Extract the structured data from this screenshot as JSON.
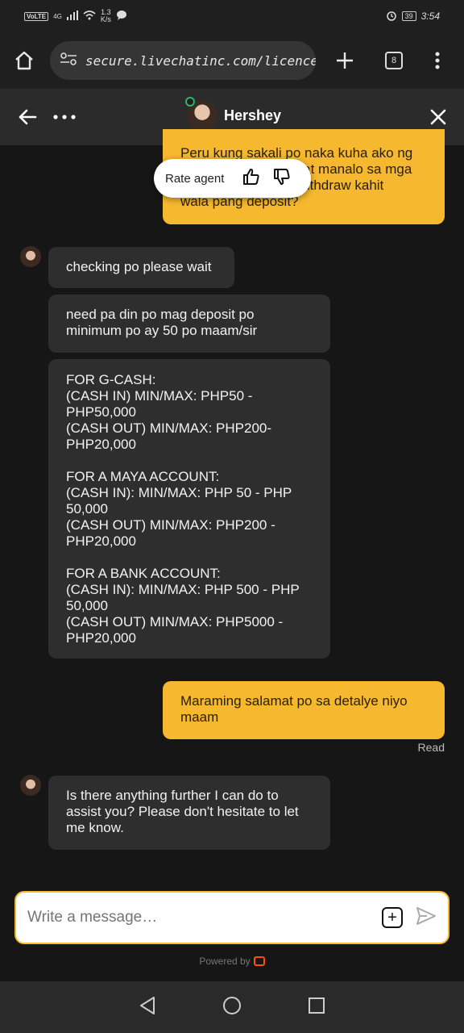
{
  "status_bar": {
    "network": "VoLTE",
    "signal_type": "4G",
    "speed": "1.3",
    "speed_unit": "K/s",
    "battery": "39",
    "time": "3:54"
  },
  "browser": {
    "url": "secure.livechatinc.com/licence/",
    "tab_count": "8"
  },
  "chat_header": {
    "agent_name": "Hershey",
    "status_color": "#2fb46b"
  },
  "rate_popup": {
    "label": "Rate agent"
  },
  "messages": [
    {
      "from": "visitor",
      "text": "Peru kung sakali po naka kuha ako ng\nwin sa game? pag nat manalo sa mga\nlaro mo po makakawithdraw kahit\nwala pang deposit?"
    },
    {
      "from": "agent",
      "text": "checking po please wait"
    },
    {
      "from": "agent",
      "text": "need pa din po mag deposit po\nminimum po ay 50 po maam/sir"
    },
    {
      "from": "agent",
      "text": "FOR G-CASH:\n(CASH IN) MIN/MAX: PHP50 -\nPHP50,000\n(CASH OUT) MIN/MAX: PHP200-\nPHP20,000\n\nFOR A MAYA ACCOUNT:\n(CASH IN): MIN/MAX: PHP 50 - PHP\n50,000\n(CASH OUT) MIN/MAX: PHP200 -\nPHP20,000\n\nFOR A BANK ACCOUNT:\n(CASH IN): MIN/MAX: PHP 500 - PHP\n50,000\n(CASH OUT) MIN/MAX: PHP5000 -\nPHP20,000"
    },
    {
      "from": "visitor",
      "text": "Maraming salamat po sa detalye niyo\nmaam"
    },
    {
      "from": "agent",
      "text": "Is there anything further I can do to\nassist you? Please don't hesitate to let\nme know."
    }
  ],
  "read_status": "Read",
  "composer": {
    "placeholder": "Write a message…"
  },
  "powered_by": "Powered by",
  "colors": {
    "accent": "#f5b82e",
    "brand": "#ff5100"
  }
}
